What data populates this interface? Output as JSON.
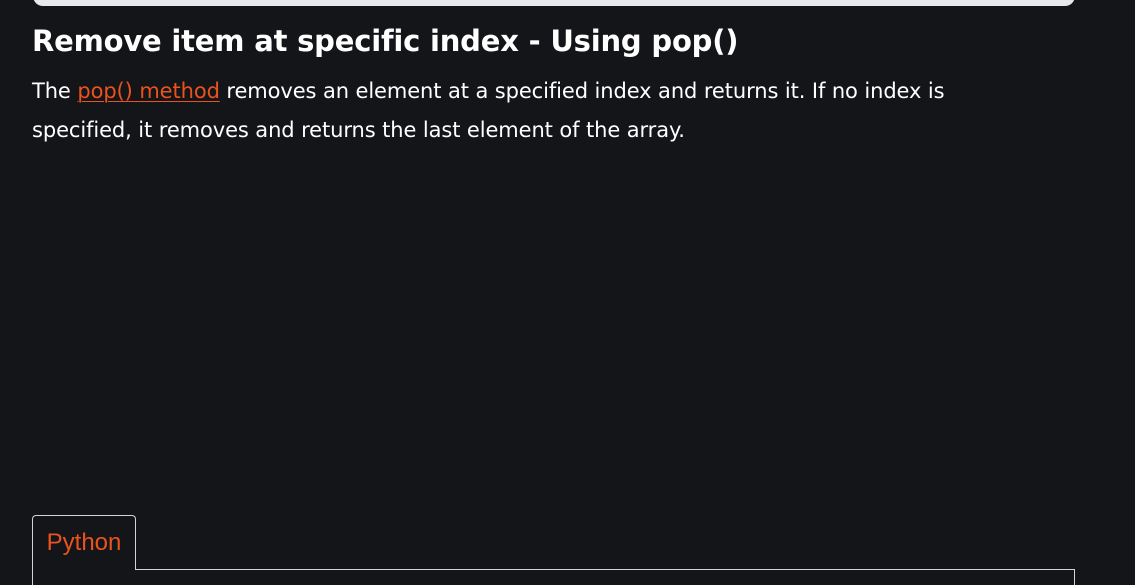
{
  "article": {
    "title": "Remove item at specific index - Using pop()",
    "description": {
      "prefix": "The ",
      "link_text": "pop() method",
      "suffix": " removes an element at a specified index and returns it. If no index is specified, it removes and returns the last element of the array."
    }
  },
  "code_block": {
    "tabs": [
      {
        "label": "Python"
      }
    ]
  },
  "colors": {
    "background": "#141519",
    "accent": "#e9531d",
    "text": "#ffffff",
    "border": "#d4d4d8"
  }
}
